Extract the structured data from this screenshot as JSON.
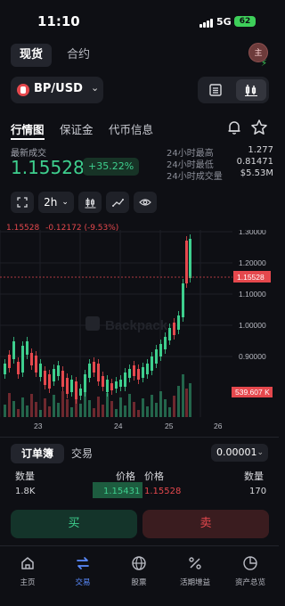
{
  "status": {
    "time": "11:10",
    "network": "5G",
    "battery": "62"
  },
  "market_tabs": [
    "现货",
    "合约"
  ],
  "avatar_text": "主",
  "pair": "BP/USD",
  "sub_tabs": [
    "行情图",
    "保证金",
    "代币信息"
  ],
  "ticker": {
    "latest_label": "最新成交",
    "price": "1.15528",
    "change": "+35.22%",
    "stats": [
      {
        "label": "24小时最高",
        "value": "1.277"
      },
      {
        "label": "24小时最低",
        "value": "0.81471"
      },
      {
        "label": "24小时成交量",
        "value": "$5.53M"
      }
    ]
  },
  "toolbar": {
    "interval": "2h"
  },
  "chart_data": {
    "type": "candlestick",
    "legend": {
      "price": "1.15528",
      "change": "-0.12172",
      "pct": "(-9.53%)"
    },
    "y_ticks": [
      "1.30000",
      "1.20000",
      "1.10000",
      "1.00000",
      "0.90000"
    ],
    "x_ticks": [
      "23",
      "24",
      "25",
      "26"
    ],
    "last_price_tag": "1.15528",
    "volume_tag": "539.607 K",
    "watermark": "Backpack"
  },
  "orderbook": {
    "tabs": [
      "订单簿",
      "交易"
    ],
    "precision": "0.00001",
    "headers": {
      "qty_left": "数量",
      "price_left": "价格",
      "price_right": "价格",
      "qty_right": "数量"
    },
    "row": {
      "bid_qty": "1.8K",
      "bid_price": "1.15431",
      "ask_price": "1.15528",
      "ask_qty": "170"
    }
  },
  "actions": {
    "buy": "买",
    "sell": "卖"
  },
  "nav": [
    "主页",
    "交易",
    "股票",
    "活期增益",
    "资产总览"
  ],
  "colors": {
    "up": "#3ecf8e",
    "down": "#e5484d",
    "accent": "#5b8cff"
  }
}
